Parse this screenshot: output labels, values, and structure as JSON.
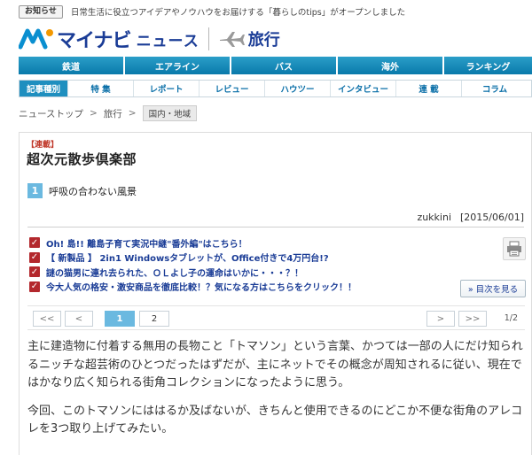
{
  "notice": {
    "badge": "お知らせ",
    "text": "日常生活に役立つアイデアやノウハウをお届けする「暮らしのtips」がオープンしました"
  },
  "header": {
    "brand": "マイナビ",
    "news": "ニュース",
    "travel": "旅行",
    "brand_color": "#1a3c96"
  },
  "main_nav": [
    "鉄道",
    "エアライン",
    "バス",
    "海外",
    "ランキング"
  ],
  "sub_nav": {
    "title": "記事種別",
    "items": [
      "特 集",
      "レポート",
      "レビュー",
      "ハウツー",
      "インタビュー",
      "連 載",
      "コラム"
    ]
  },
  "breadcrumb": {
    "items": [
      "ニューストップ",
      "旅行"
    ],
    "sep": ">",
    "current": "国内・地域"
  },
  "article": {
    "series_tag": "【連載】",
    "series_title": "超次元散歩倶楽部",
    "chapter_num": "1",
    "chapter_title": "呼吸の合わない風景",
    "author": "zukkini",
    "date": "[2015/06/01]",
    "toc_button": "» 目次を見る",
    "paragraphs": [
      "主に建造物に付着する無用の長物こと「トマソン」という言葉、かつては一部の人にだけ知られるニッチな超芸術のひとつだったはずだが、主にネットでその概念が周知されるに従い、現在ではかなり広く知られる街角コレクションになったように思う。",
      "今回、このトマソンにははるか及ばないが、きちんと使用できるのにどこか不便な街角のアレコレを3つ取り上げてみたい。"
    ]
  },
  "promos": [
    "Oh! 島!! 離島子育て実況中継\"番外編\"はこちら！",
    "【 新製品 】 2in1 Windowsタブレットが、Office付きで4万円台!?",
    "謎の猫男に連れ去られた、ＯＬよし子の運命はいかに・・・？！",
    "今大人気の格安・激安商品を徹底比較！？気になる方はこちらをクリック！！"
  ],
  "pager": {
    "first": "<<",
    "prev": "<",
    "pages": [
      "1",
      "2"
    ],
    "next": ">",
    "last": ">>",
    "count": "1/2"
  },
  "icons": [
    "check-icon",
    "printer-icon",
    "plane-icon",
    "logo-mark-icon"
  ],
  "colors": {
    "nav": "#0a7aab",
    "accent": "#6bb9e0",
    "check": "#b3282d"
  }
}
